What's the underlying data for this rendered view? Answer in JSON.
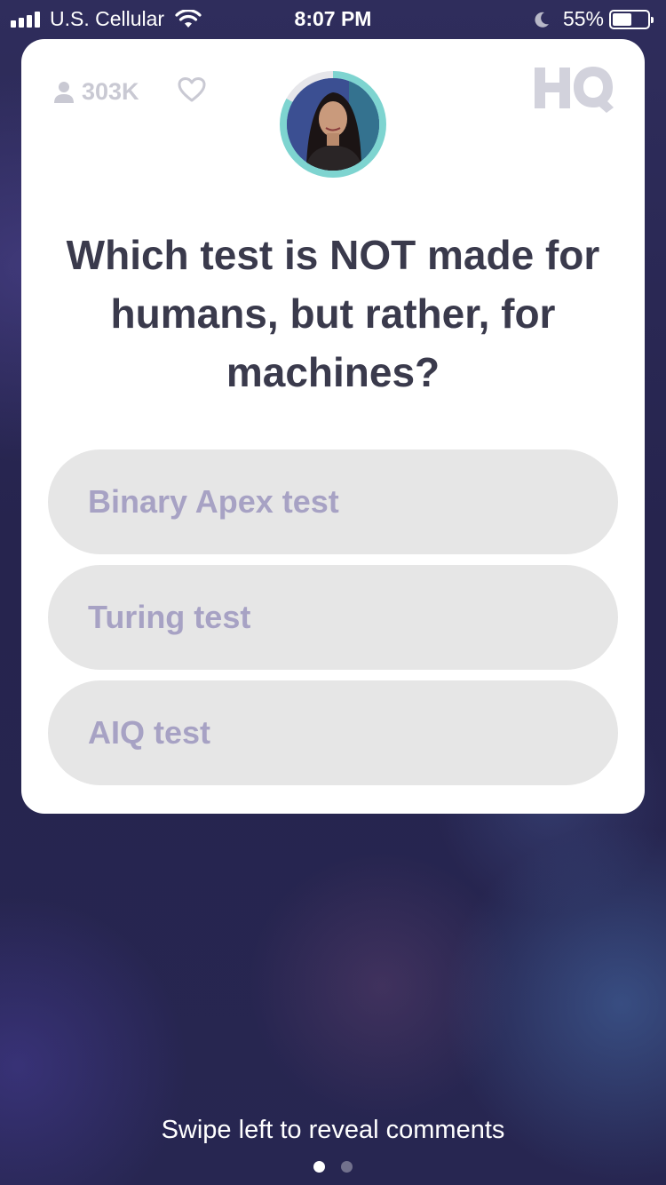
{
  "status_bar": {
    "carrier": "U.S. Cellular",
    "time": "8:07 PM",
    "battery_percent": "55%",
    "battery_level": 0.55,
    "icons": [
      "signal-icon",
      "wifi-icon",
      "moon-icon",
      "battery-icon"
    ]
  },
  "card": {
    "viewer_count": "303K",
    "logo_text": "HQ",
    "host_timer_progress": 0.83,
    "question": "Which test is NOT made for humans, but rather, for machines?",
    "answers": [
      {
        "label": "Binary Apex test"
      },
      {
        "label": "Turing test"
      },
      {
        "label": "AIQ test"
      }
    ]
  },
  "footer": {
    "swipe_hint": "Swipe left to reveal comments",
    "page_count": 2,
    "active_page": 1
  },
  "colors": {
    "card_background": "#ffffff",
    "question_text": "#3a3a4c",
    "answer_background": "#e6e6e6",
    "answer_text": "#a7a2c4",
    "timer_ring": "#7ed4d0",
    "muted_icons": "#c9c9d3"
  }
}
